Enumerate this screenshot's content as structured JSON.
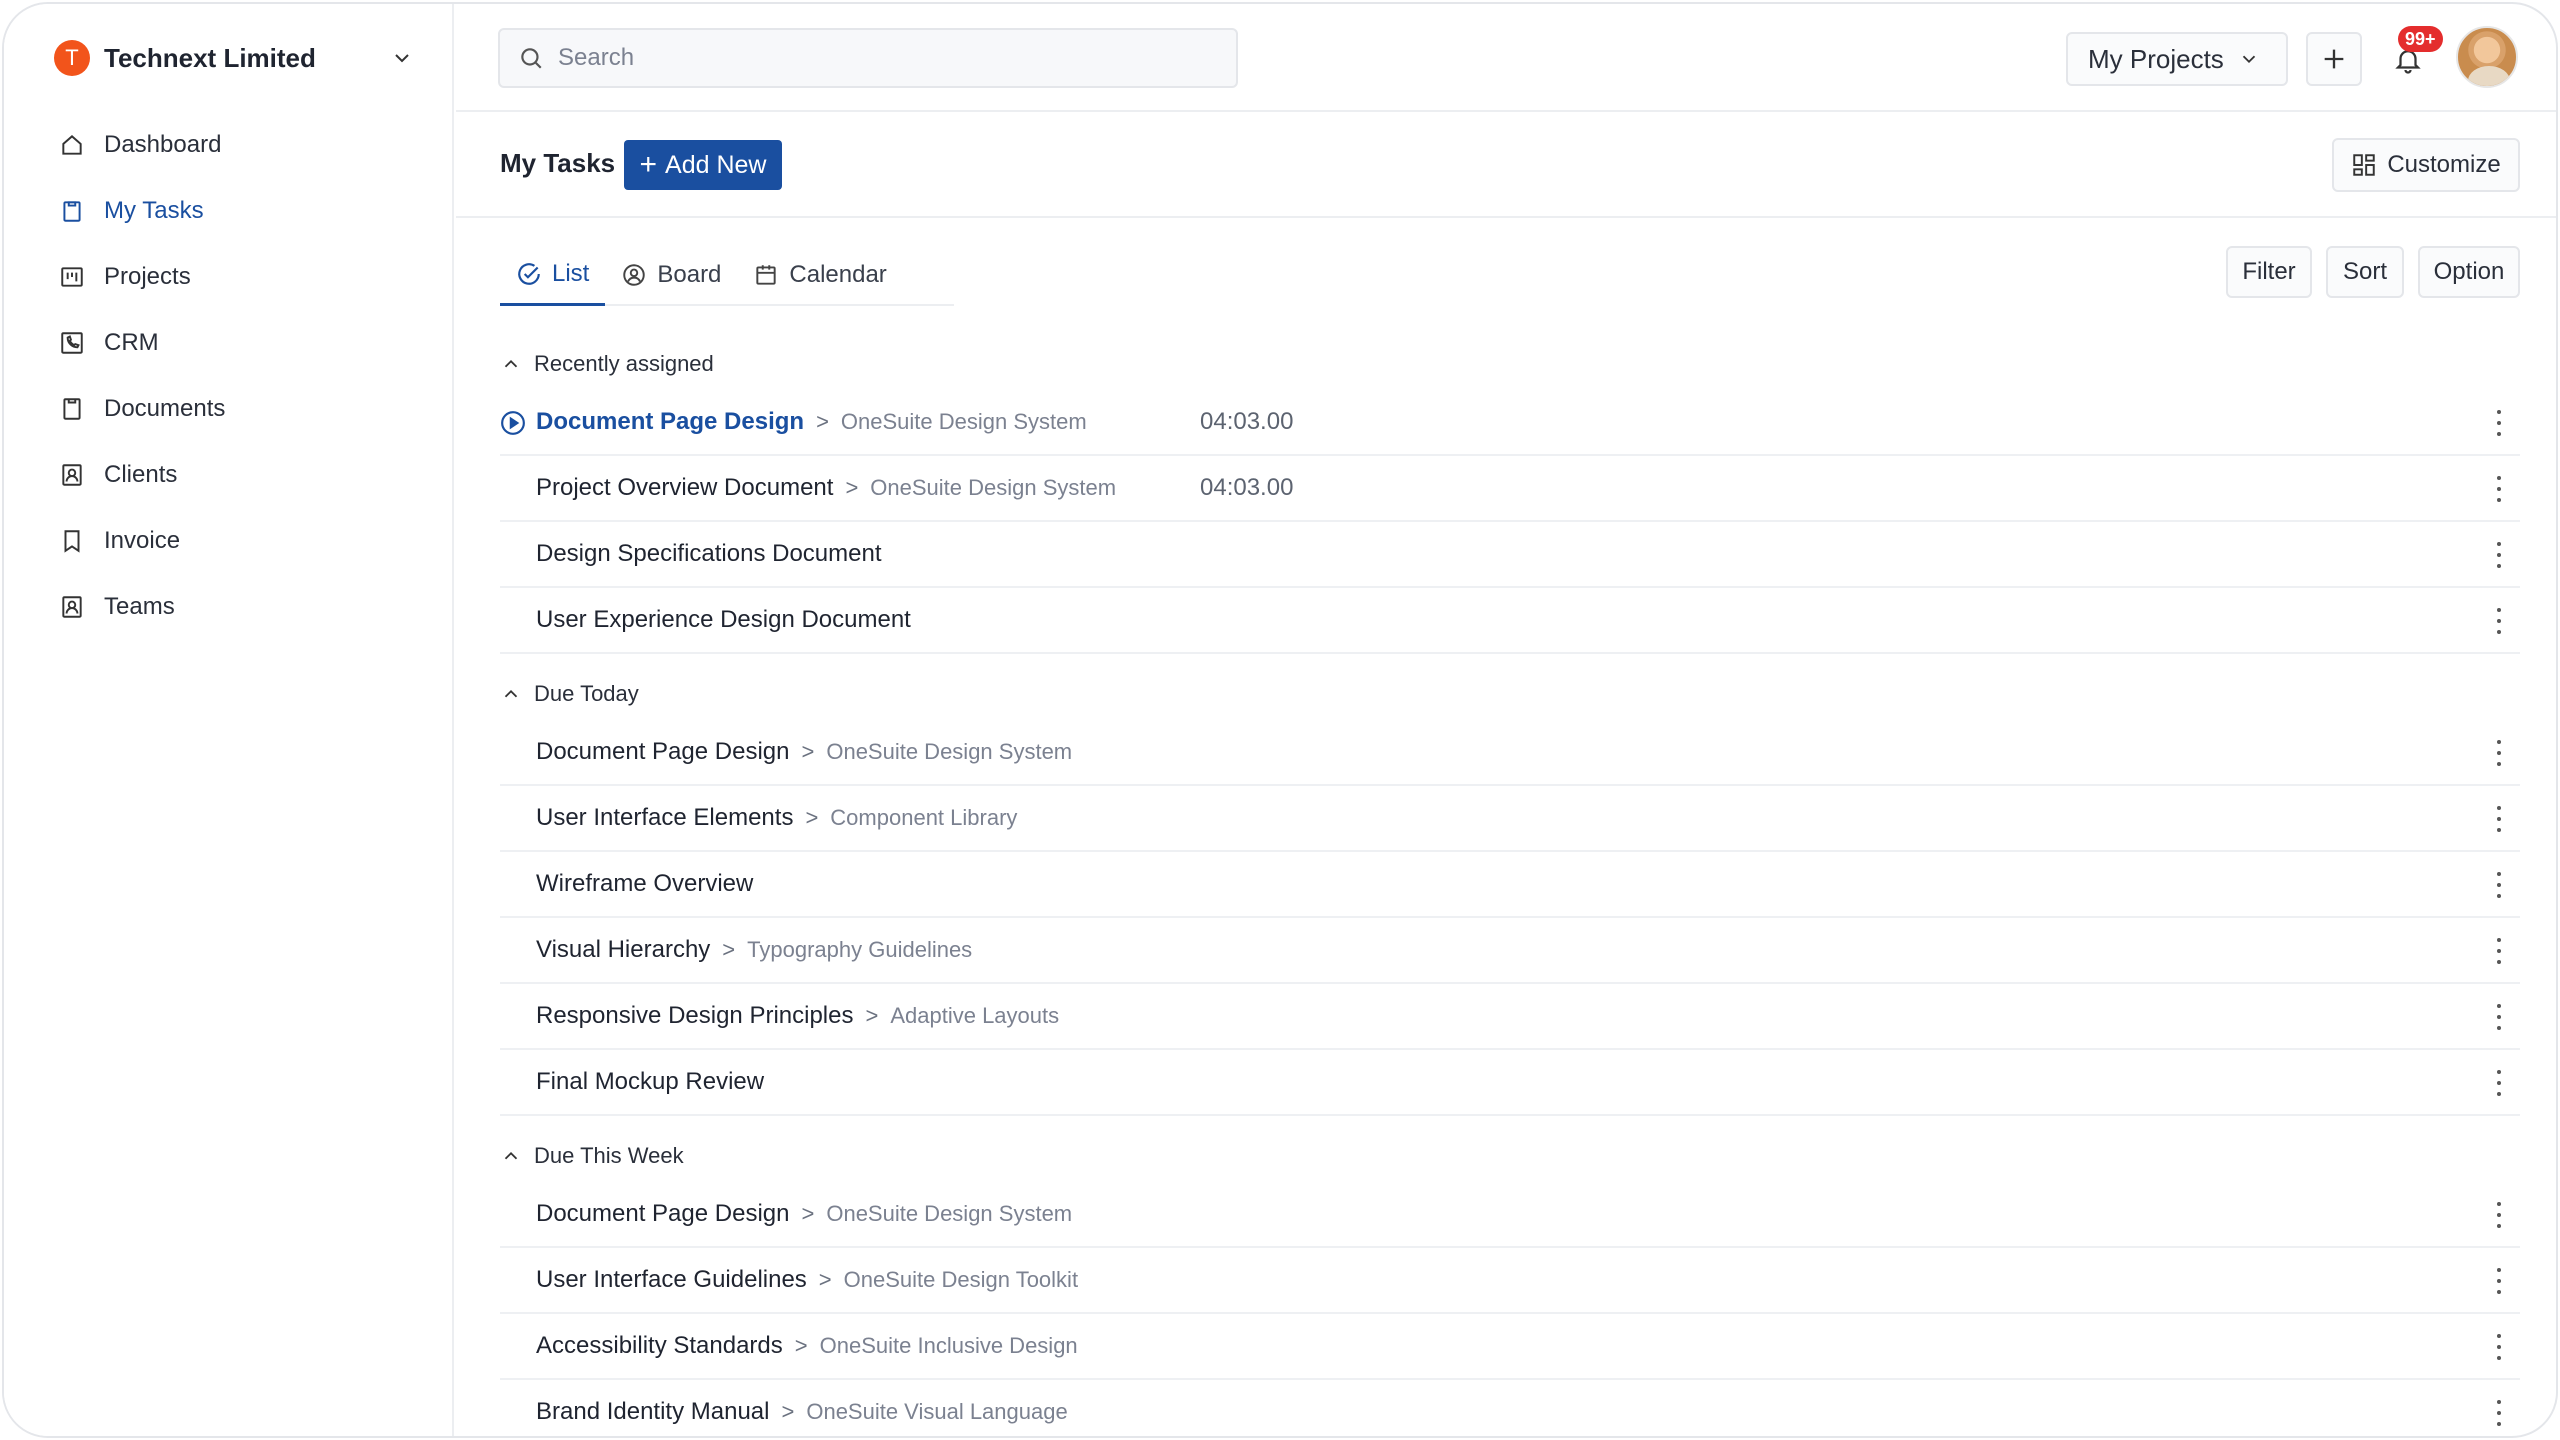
{
  "org": {
    "initial": "T",
    "name": "Technext Limited"
  },
  "sidebar": {
    "items": [
      {
        "label": "Dashboard",
        "icon": "home-icon",
        "active": false
      },
      {
        "label": "My Tasks",
        "icon": "clipboard-icon",
        "active": true
      },
      {
        "label": "Projects",
        "icon": "kanban-icon",
        "active": false
      },
      {
        "label": "CRM",
        "icon": "phone-icon",
        "active": false
      },
      {
        "label": "Documents",
        "icon": "document-icon",
        "active": false
      },
      {
        "label": "Clients",
        "icon": "contact-icon",
        "active": false
      },
      {
        "label": "Invoice",
        "icon": "bookmark-icon",
        "active": false
      },
      {
        "label": "Teams",
        "icon": "team-icon",
        "active": false
      }
    ]
  },
  "header": {
    "search_placeholder": "Search",
    "project_select": "My Projects",
    "notification_count": "99+"
  },
  "page": {
    "title": "My Tasks",
    "add_new_label": "Add New",
    "customize_label": "Customize"
  },
  "tabs": [
    {
      "label": "List",
      "active": true
    },
    {
      "label": "Board",
      "active": false
    },
    {
      "label": "Calendar",
      "active": false
    }
  ],
  "toolbar": {
    "filter_label": "Filter",
    "sort_label": "Sort",
    "option_label": "Option"
  },
  "groups": [
    {
      "title": "Recently assigned",
      "tasks": [
        {
          "name": "Document Page Design",
          "project": "OneSuite Design System",
          "time": "04:03.00",
          "highlighted": true
        },
        {
          "name": "Project Overview Document",
          "project": "OneSuite Design System",
          "time": "04:03.00",
          "highlighted": false
        },
        {
          "name": "Design Specifications Document",
          "project": "",
          "time": "",
          "highlighted": false
        },
        {
          "name": "User Experience Design Document",
          "project": "",
          "time": "",
          "highlighted": false
        }
      ]
    },
    {
      "title": "Due Today",
      "tasks": [
        {
          "name": "Document Page Design",
          "project": "OneSuite Design System",
          "time": "",
          "highlighted": false
        },
        {
          "name": "User Interface Elements",
          "project": "Component Library",
          "time": "",
          "highlighted": false
        },
        {
          "name": "Wireframe Overview",
          "project": "",
          "time": "",
          "highlighted": false
        },
        {
          "name": "Visual Hierarchy",
          "project": "Typography Guidelines",
          "time": "",
          "highlighted": false
        },
        {
          "name": "Responsive Design Principles",
          "project": "Adaptive Layouts",
          "time": "",
          "highlighted": false
        },
        {
          "name": "Final Mockup Review",
          "project": "",
          "time": "",
          "highlighted": false
        }
      ]
    },
    {
      "title": "Due This Week",
      "tasks": [
        {
          "name": "Document Page Design",
          "project": "OneSuite Design System",
          "time": "",
          "highlighted": false
        },
        {
          "name": "User Interface Guidelines",
          "project": "OneSuite Design Toolkit",
          "time": "",
          "highlighted": false
        },
        {
          "name": "Accessibility Standards",
          "project": "OneSuite Inclusive Design",
          "time": "",
          "highlighted": false
        },
        {
          "name": "Brand Identity Manual",
          "project": "OneSuite Visual Language",
          "time": "",
          "highlighted": false
        }
      ]
    }
  ],
  "colors": {
    "accent": "#1a4fa0",
    "org_logo": "#f2541b",
    "badge": "#e42d2d"
  }
}
